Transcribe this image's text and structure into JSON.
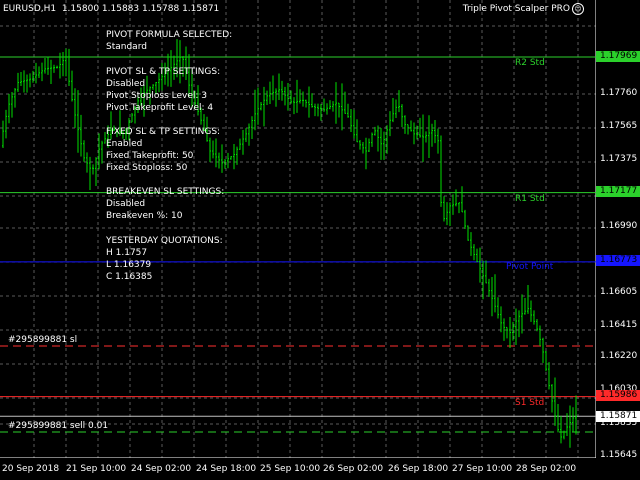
{
  "window": {
    "symbol_info": "EURUSD,H1  1.15800 1.15883 1.15788 1.15871",
    "indicator_name": "Triple Pivot Scalper PRO",
    "indicator_icon": "smiley-icon"
  },
  "colors": {
    "background": "#000000",
    "grid": "#5a5a5a",
    "candles": "#00e000",
    "r_level": "#2bd12b",
    "pivot": "#1515ff",
    "s_level": "#ff2a2a",
    "sl_line": "#ff3030",
    "order_line": "#2bd12b",
    "current_price": "#c0c0c0"
  },
  "info_panel": {
    "formula_heading": "PIVOT FORMULA SELECTED:",
    "formula_value": "Standard",
    "pivot_sltp_heading": "PIVOT SL & TP SETTINGS:",
    "pivot_sltp_status": "Disabled",
    "pivot_sl_level": "Pivot Stoploss Level: 3",
    "pivot_tp_level": "Pivot Takeprofit Level: 4",
    "fixed_heading": "FIXED SL & TP SETTINGS:",
    "fixed_status": "Enabled",
    "fixed_tp": "Fixed Takeprofit: 50",
    "fixed_sl": "Fixed Stoploss: 50",
    "breakeven_heading": "BREAKEVEN SL SETTINGS:",
    "breakeven_status": "Disabled",
    "breakeven_pct": "Breakeven %: 10",
    "yesterday_heading": "YESTERDAY QUOTATIONS:",
    "yesterday_h": "H 1.1757",
    "yesterday_l": "L 1.16379",
    "yesterday_c": "C 1.16385"
  },
  "levels": {
    "r2": {
      "label": "R2 Std",
      "price": "1.17969"
    },
    "r1": {
      "label": "R1 Std",
      "price": "1.17177"
    },
    "pivot": {
      "label": "Pivot Point",
      "price": "1.16773"
    },
    "s1": {
      "label": "S1 Std",
      "price": "1.15986"
    },
    "current": {
      "price": "1.15871"
    }
  },
  "orders": {
    "sl_label": "#295899881 sl",
    "sell_label": "#295899881 sell 0.01"
  },
  "y_axis": {
    "ticks": [
      "1.17969",
      "1.17760",
      "1.17565",
      "1.17375",
      "1.17177",
      "1.16990",
      "1.16773",
      "1.16605",
      "1.16415",
      "1.16220",
      "1.16030",
      "1.15986",
      "1.15871",
      "1.15835",
      "1.15645"
    ]
  },
  "x_axis": {
    "ticks": [
      "20 Sep 2018",
      "21 Sep 10:00",
      "24 Sep 02:00",
      "24 Sep 18:00",
      "25 Sep 10:00",
      "26 Sep 02:00",
      "26 Sep 18:00",
      "27 Sep 10:00",
      "28 Sep 02:00"
    ]
  }
}
